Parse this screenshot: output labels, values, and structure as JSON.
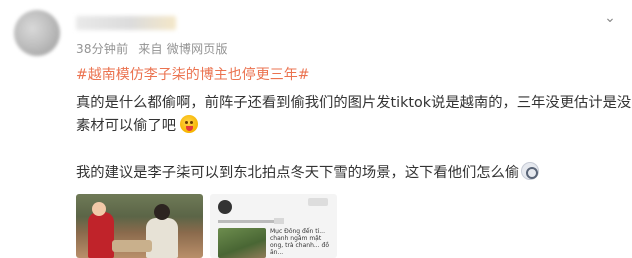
{
  "post": {
    "time": "38分钟前",
    "source": "来自 微博网页版",
    "hashtag": "#越南模仿李子柒的博主也停更三年#",
    "line1": "真的是什么都偷啊，前阵子还看到偷我们的图片发tiktok说是越南的，三年没更估计是没",
    "line2": "素材可以偷了吧",
    "line3": "我的建议是李子柒可以到东北拍点冬天下雪的场景，这下看他们怎么偷",
    "more_icon": "chevron-down-icon",
    "emoji1": "tongue-out-emoji",
    "emoji2": "face-emoji"
  },
  "thumbnails": {
    "second_caption": "Mục Đông đến tỉ... chanh ngâm mật ong, trà chanh... đồ ăn..."
  }
}
